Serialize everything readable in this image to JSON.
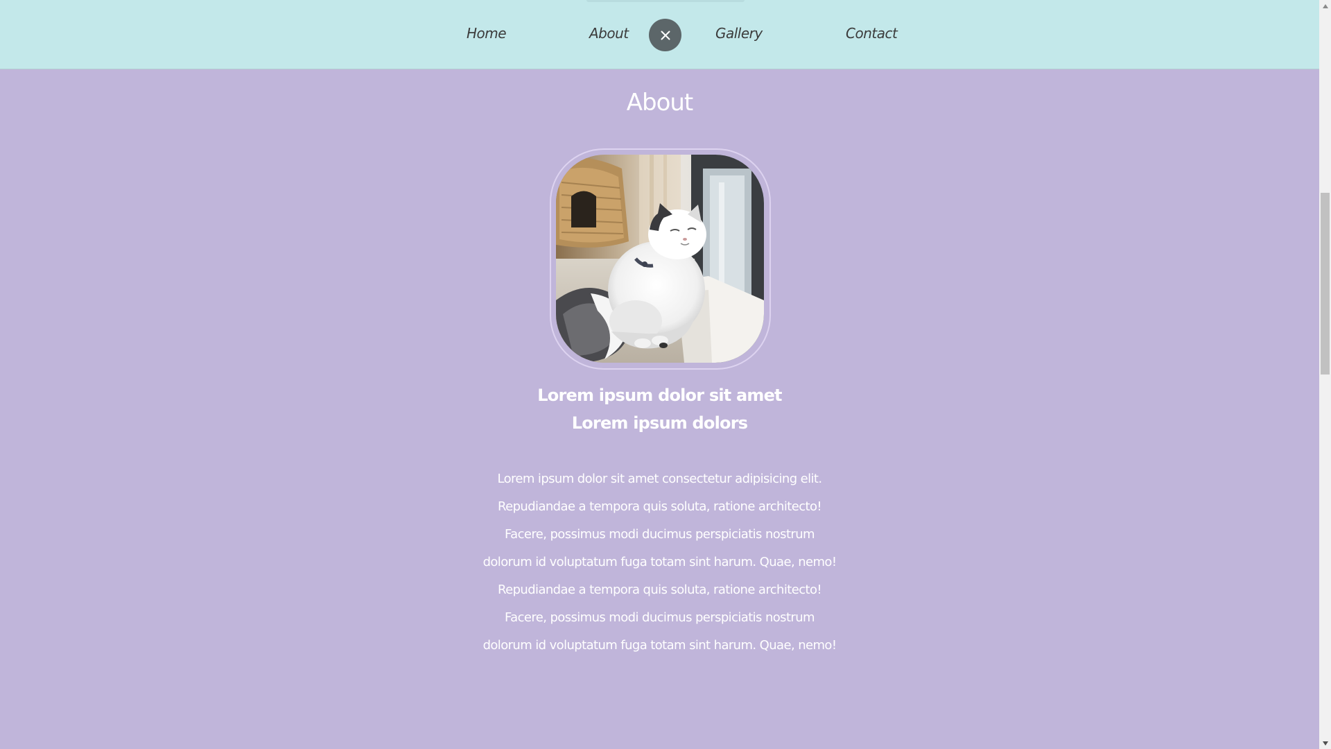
{
  "nav": {
    "items": [
      {
        "label": "Home"
      },
      {
        "label": "About"
      },
      {
        "label": "Gallery"
      },
      {
        "label": "Contact"
      }
    ],
    "close_icon": "close-icon"
  },
  "about": {
    "title": "About",
    "photo_icon": "cat-photo",
    "subtitle_1": "Lorem ipsum dolor sit amet",
    "subtitle_2": "Lorem ipsum dolors",
    "lines": [
      "Lorem ipsum dolor sit amet consectetur adipisicing elit.",
      "Repudiandae a tempora quis soluta, ratione architecto!",
      "Facere, possimus modi ducimus perspiciatis nostrum",
      "dolorum id voluptatum fuga totam sint harum. Quae, nemo!",
      "Repudiandae a tempora quis soluta, ratione architecto!",
      "Facere, possimus modi ducimus perspiciatis nostrum",
      "dolorum id voluptatum fuga totam sint harum. Quae, nemo!"
    ]
  },
  "colors": {
    "navbar_bg": "#c3e8ea",
    "page_bg": "#c0b5da",
    "close_button_bg": "#5c6669",
    "text_light": "#ffffff",
    "nav_text": "#3b3b3b"
  }
}
